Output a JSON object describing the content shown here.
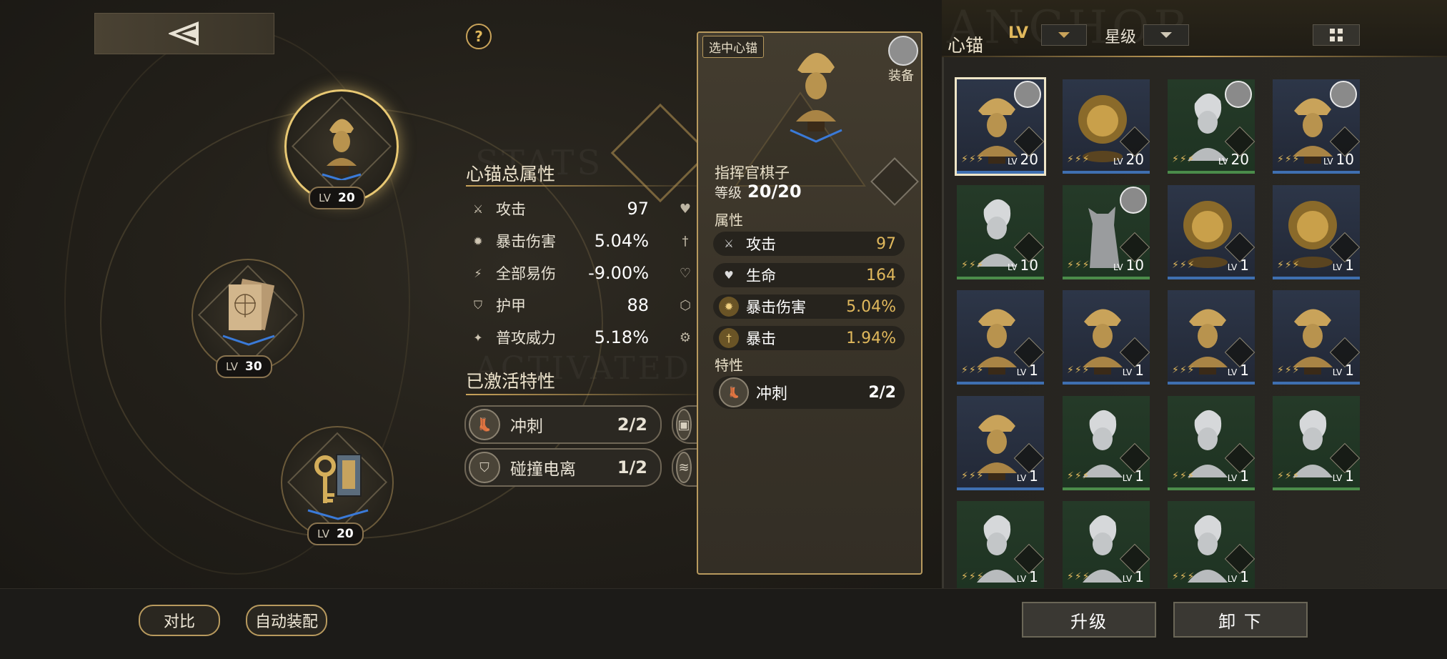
{
  "header": {
    "back_icon": "back-triangle-icon",
    "help_label": "?"
  },
  "background_text": [
    "STATS",
    "ACTIVATED",
    "ANCHOR"
  ],
  "slots": [
    {
      "name": "指挥官棋子",
      "lv_label": "LV",
      "level": "20",
      "selected": true
    },
    {
      "name": "document",
      "lv_label": "LV",
      "level": "30"
    },
    {
      "name": "key",
      "lv_label": "LV",
      "level": "20"
    }
  ],
  "stats": {
    "title": "心锚总属性",
    "rows": [
      {
        "name": "攻击",
        "value": "97",
        "icon": "sword-icon"
      },
      {
        "name": "暴击伤害",
        "value": "5.04%",
        "icon": "crit-damage-icon"
      },
      {
        "name": "全部易伤",
        "value": "-9.00%",
        "icon": "vulnerability-icon"
      },
      {
        "name": "护甲",
        "value": "88",
        "icon": "shield-icon"
      },
      {
        "name": "普攻威力",
        "value": "5.18%",
        "icon": "attack-power-icon"
      }
    ]
  },
  "traits": {
    "title": "已激活特性",
    "items": [
      {
        "name": "冲刺",
        "value": "2/2"
      },
      {
        "name": "碰撞电离",
        "value": "1/2"
      }
    ]
  },
  "detail": {
    "selected_tag": "选中心锚",
    "equip_label": "装备",
    "name": "指挥官棋子",
    "level_label": "等级",
    "level_value": "20/20",
    "attr_title": "属性",
    "attrs": [
      {
        "name": "攻击",
        "value": "97"
      },
      {
        "name": "生命",
        "value": "164"
      },
      {
        "name": "暴击伤害",
        "value": "5.04%"
      },
      {
        "name": "暴击",
        "value": "1.94%"
      }
    ],
    "trait_title": "特性",
    "trait": {
      "name": "冲刺",
      "value": "2/2"
    }
  },
  "inventory": {
    "title": "心锚",
    "bg_word": "ANCHOR",
    "filter_lv": "LV",
    "filter_star": "星级",
    "grid_icon": "grid-view-icon",
    "lv_label": "LV",
    "cards": [
      {
        "kind": "gold",
        "level": "20",
        "avatar": true,
        "selected": true
      },
      {
        "kind": "lion",
        "level": "20"
      },
      {
        "kind": "silver",
        "level": "20",
        "avatar": true
      },
      {
        "kind": "gold",
        "level": "10",
        "avatar": true
      },
      {
        "kind": "silver",
        "level": "10"
      },
      {
        "kind": "cat",
        "level": "10",
        "avatar": true
      },
      {
        "kind": "lion",
        "level": "1"
      },
      {
        "kind": "lion",
        "level": "1"
      },
      {
        "kind": "gold",
        "level": "1"
      },
      {
        "kind": "gold",
        "level": "1"
      },
      {
        "kind": "gold",
        "level": "1"
      },
      {
        "kind": "gold",
        "level": "1"
      },
      {
        "kind": "gold",
        "level": "1"
      },
      {
        "kind": "silver",
        "level": "1"
      },
      {
        "kind": "silver",
        "level": "1"
      },
      {
        "kind": "silver",
        "level": "1"
      },
      {
        "kind": "silver",
        "level": "1"
      },
      {
        "kind": "silver",
        "level": "1"
      },
      {
        "kind": "silver",
        "level": "1"
      }
    ]
  },
  "actions": {
    "compare": "对比",
    "auto_equip": "自动装配",
    "upgrade": "升级",
    "unequip": "卸 下"
  }
}
